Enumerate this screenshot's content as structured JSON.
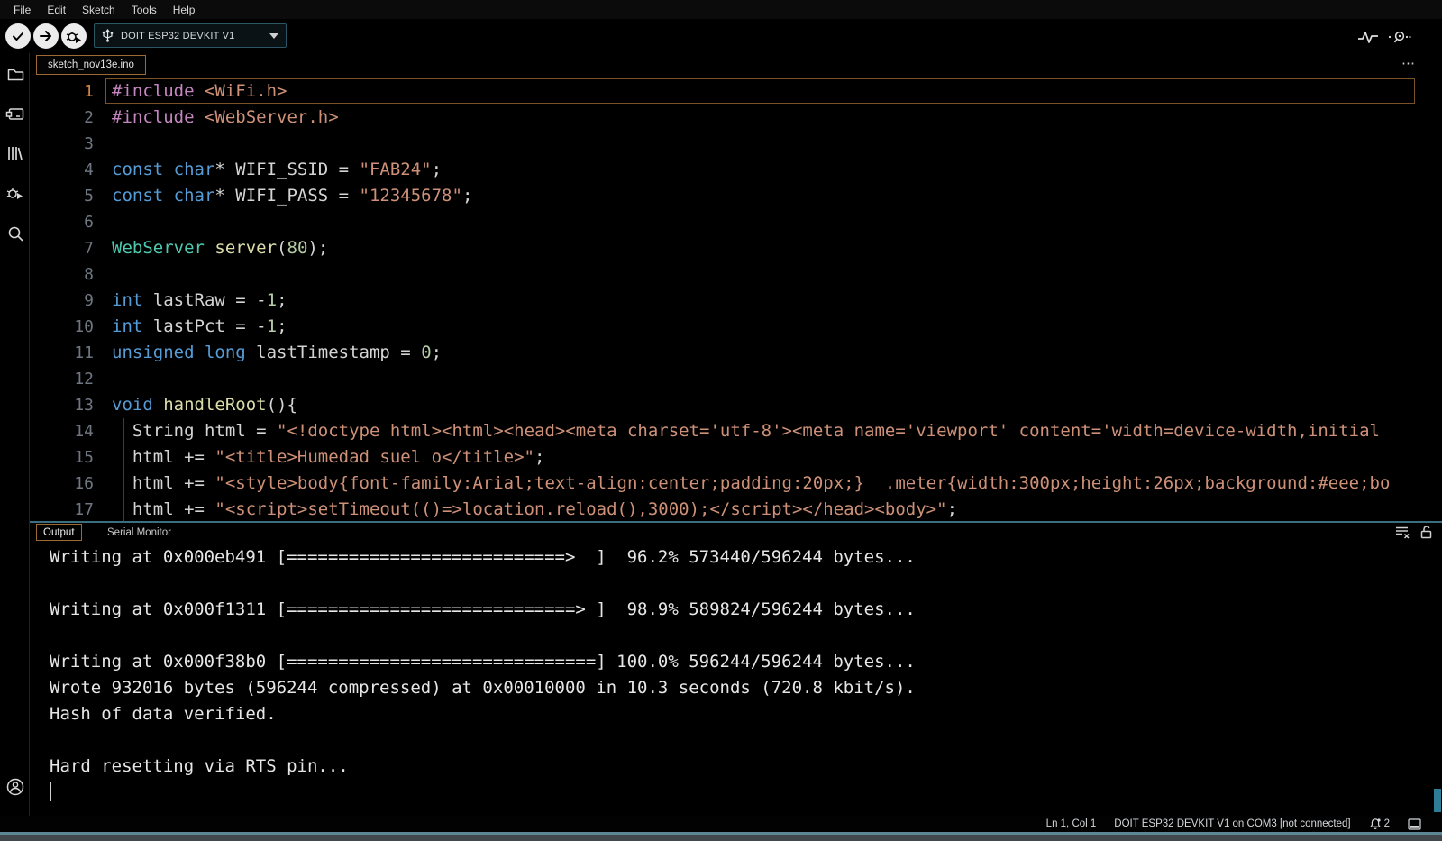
{
  "menu": {
    "items": [
      "File",
      "Edit",
      "Sketch",
      "Tools",
      "Help"
    ]
  },
  "toolbar": {
    "verify_tooltip": "Verify",
    "upload_tooltip": "Upload",
    "debug_tooltip": "Start Debugging",
    "board_selector": {
      "label": "DOIT ESP32 DEVKIT V1"
    }
  },
  "tab_bar": {
    "active_tab": "sketch_nov13e.ino",
    "more_actions": "⋯"
  },
  "editor": {
    "active_line": 1,
    "lines": [
      {
        "n": 1,
        "tokens": [
          [
            "kw",
            "#include"
          ],
          [
            "pl",
            " "
          ],
          [
            "str",
            "<WiFi.h>"
          ]
        ]
      },
      {
        "n": 2,
        "tokens": [
          [
            "kw",
            "#include"
          ],
          [
            "pl",
            " "
          ],
          [
            "str",
            "<WebServer.h>"
          ]
        ]
      },
      {
        "n": 3,
        "tokens": []
      },
      {
        "n": 4,
        "tokens": [
          [
            "type",
            "const char"
          ],
          [
            "pl",
            "* WIFI_SSID = "
          ],
          [
            "str",
            "\"FAB24\""
          ],
          [
            "pl",
            ";"
          ]
        ]
      },
      {
        "n": 5,
        "tokens": [
          [
            "type",
            "const char"
          ],
          [
            "pl",
            "* WIFI_PASS = "
          ],
          [
            "str",
            "\"12345678\""
          ],
          [
            "pl",
            ";"
          ]
        ]
      },
      {
        "n": 6,
        "tokens": []
      },
      {
        "n": 7,
        "tokens": [
          [
            "cls",
            "WebServer"
          ],
          [
            "pl",
            " "
          ],
          [
            "fn",
            "server"
          ],
          [
            "pl",
            "("
          ],
          [
            "num",
            "80"
          ],
          [
            "pl",
            ");"
          ]
        ]
      },
      {
        "n": 8,
        "tokens": []
      },
      {
        "n": 9,
        "tokens": [
          [
            "type",
            "int"
          ],
          [
            "pl",
            " lastRaw = -"
          ],
          [
            "num",
            "1"
          ],
          [
            "pl",
            ";"
          ]
        ]
      },
      {
        "n": 10,
        "tokens": [
          [
            "type",
            "int"
          ],
          [
            "pl",
            " lastPct = -"
          ],
          [
            "num",
            "1"
          ],
          [
            "pl",
            ";"
          ]
        ]
      },
      {
        "n": 11,
        "tokens": [
          [
            "type",
            "unsigned long"
          ],
          [
            "pl",
            " lastTimestamp = "
          ],
          [
            "num",
            "0"
          ],
          [
            "pl",
            ";"
          ]
        ]
      },
      {
        "n": 12,
        "tokens": []
      },
      {
        "n": 13,
        "tokens": [
          [
            "type",
            "void"
          ],
          [
            "pl",
            " "
          ],
          [
            "fn",
            "handleRoot"
          ],
          [
            "pl",
            "(){"
          ]
        ]
      },
      {
        "n": 14,
        "tokens": [
          [
            "pl",
            "  String html = "
          ],
          [
            "str",
            "\"<!doctype html><html><head><meta charset='utf-8'><meta name='viewport' content='width=device-width,initial"
          ]
        ]
      },
      {
        "n": 15,
        "tokens": [
          [
            "pl",
            "  html += "
          ],
          [
            "str",
            "\"<title>Humedad suel o</title>\""
          ],
          [
            "pl",
            ";"
          ]
        ]
      },
      {
        "n": 16,
        "tokens": [
          [
            "pl",
            "  html += "
          ],
          [
            "str",
            "\"<style>body{font-family:Arial;text-align:center;padding:20px;}  .meter{width:300px;height:26px;background:#eee;bo"
          ]
        ]
      },
      {
        "n": 17,
        "tokens": [
          [
            "pl",
            "  html += "
          ],
          [
            "str",
            "\"<script>setTimeout(()=>location.reload(),3000);</script></head><body>\""
          ],
          [
            "pl",
            ";"
          ]
        ]
      }
    ]
  },
  "output_panel": {
    "tabs": [
      {
        "label": "Output",
        "active": true
      },
      {
        "label": "Serial Monitor",
        "active": false
      }
    ],
    "console_lines": [
      "Writing at 0x000eb491 [===========================>  ]  96.2% 573440/596244 bytes...",
      "",
      "Writing at 0x000f1311 [============================> ]  98.9% 589824/596244 bytes...",
      "",
      "Writing at 0x000f38b0 [==============================] 100.0% 596244/596244 bytes...",
      "Wrote 932016 bytes (596244 compressed) at 0x00010000 in 10.3 seconds (720.8 kbit/s).",
      "Hash of data verified.",
      "",
      "Hard resetting via RTS pin..."
    ]
  },
  "status_bar": {
    "position": "Ln 1, Col 1",
    "board_status": "DOIT ESP32 DEVKIT V1 on COM3 [not connected]",
    "notification_count": "2"
  },
  "colors": {
    "accent_tab_border": "#9c6b35",
    "current_line_border": "#7a5228",
    "panel_border": "#3a6f82",
    "keyword": "#C586C0",
    "type": "#569CD6",
    "class": "#4EC9B0",
    "function": "#DCDCAA",
    "string": "#CE9178",
    "number": "#B5CEA8",
    "status_underline": "#5c8694"
  }
}
